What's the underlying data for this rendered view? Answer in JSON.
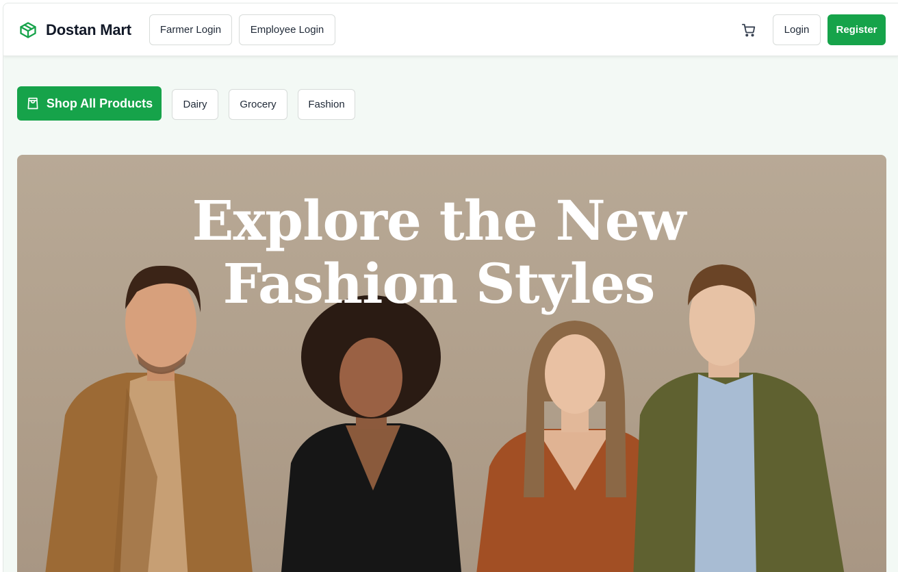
{
  "brand": {
    "name": "Dostan Mart",
    "icon": "package-icon",
    "accent": "#16a34a"
  },
  "nav": {
    "farmer_login": "Farmer Login",
    "employee_login": "Employee Login",
    "cart_icon": "cart-icon",
    "login": "Login",
    "register": "Register"
  },
  "categories": {
    "shop_all": "Shop All Products",
    "shop_all_icon": "shopping-bag-icon",
    "items": [
      "Dairy",
      "Grocery",
      "Fashion"
    ]
  },
  "hero": {
    "title_line1": "Explore the New",
    "title_line2": "Fashion Styles",
    "background": "#b5a591"
  }
}
